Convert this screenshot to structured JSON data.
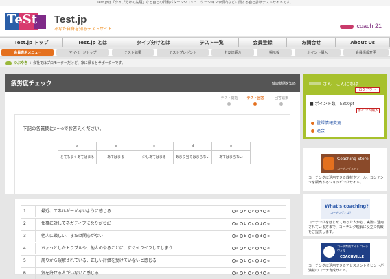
{
  "top_notice": "Test.jpは「タイプ分けの先駆」など自己の行動パターンやコミュニケーションの傾向などに関する自己診断テストサイトです。",
  "header": {
    "logo_text": "TeSt",
    "site_title": "Test.jp",
    "site_subtitle": "あなた自身を知るテストサイト",
    "brand": "coach 21"
  },
  "global_nav": [
    "Test.jp トップ",
    "Test.jp とは",
    "タイプ分けとは",
    "テスト一覧",
    "会員登録",
    "お問合せ",
    "About Us"
  ],
  "member_nav": [
    "会員専用メニュー",
    "マイページトップ",
    "テスト結果",
    "テストプレゼント",
    "お友達紹介",
    "掲示板",
    "ポイント購入",
    "会員情報変更"
  ],
  "mutter": {
    "label": "つぶやき",
    "text": "会社ではプロモーターだけど、家に帰るとサポーターです。"
  },
  "main": {
    "title": "疲労度チェック",
    "title_link": "健康状態を知る",
    "steps": [
      "テスト開始",
      "テスト回答",
      "回答結果"
    ],
    "current_step": 1,
    "instruction": "下記の各質問にa〜eでお答えください。",
    "scale_letters": [
      "a",
      "b",
      "c",
      "d",
      "e"
    ],
    "scale_labels": [
      "とてもよくあてはまる",
      "あてはまる",
      "少しあてはまる",
      "あまり当てはまらない",
      "あてはまらない"
    ],
    "options": [
      "a",
      "b",
      "c",
      "d",
      "e"
    ],
    "questions": [
      {
        "num": "1",
        "text": "最近、エネルギーがないように感じる"
      },
      {
        "num": "2",
        "text": "仕事に対してネガティブになりがちだ"
      },
      {
        "num": "3",
        "text": "他人に厳しい、または関心がない"
      },
      {
        "num": "4",
        "text": "ちょっとしたトラブルや、他人のやることに、すぐイライラしてしまう"
      },
      {
        "num": "5",
        "text": "周りから誤解されている、正しい評価を受けていないと感じる"
      },
      {
        "num": "6",
        "text": "気を許せる人がいないと感じる"
      }
    ]
  },
  "sidebar": {
    "greeting": "さん　こんにちは",
    "logout": "ログアウト",
    "points_label": "■ ポイント数",
    "points_value": "5300pt",
    "points_button": "ポイント購入",
    "links": [
      "登録情報変更",
      "退会"
    ],
    "ads": [
      {
        "img_title": "Coaching Store",
        "img_sub": "コーチングストア",
        "text": "コーチングに活用できる教材やツール、コンテンツを販売するショッピングサイト。"
      },
      {
        "img_title": "What's coaching?",
        "img_sub": "コーチングとは？",
        "text": "コーチングをはじめて知った人から、実際に活用されている方まで、コーチング理解に役立つ情報をご提供します。"
      },
      {
        "img_title": "コーチ育成サイト コーチヴィル",
        "img_sub": "COACHVILLE",
        "text": "コーチングに活用できるアセスメントやヒントが満載のコーチ育成サイト。"
      }
    ]
  },
  "colors": {
    "accent": "#e4701e",
    "sidebar_green": "#a7c12d",
    "title_bar": "#555555"
  }
}
